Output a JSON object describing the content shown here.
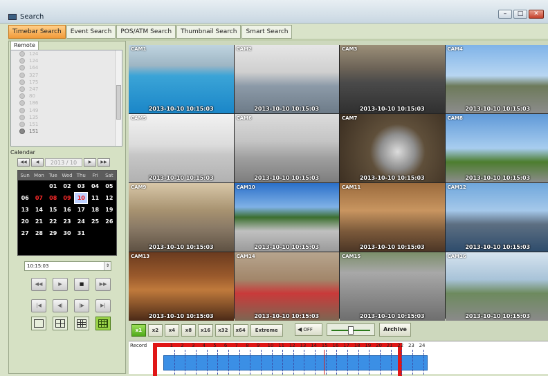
{
  "window": {
    "title": "Search"
  },
  "tabs": [
    {
      "label": "Timebar Search",
      "active": true
    },
    {
      "label": "Event Search"
    },
    {
      "label": "POS/ATM Search"
    },
    {
      "label": "Thumbnail Search"
    },
    {
      "label": "Smart Search"
    }
  ],
  "remote": {
    "tab_label": "Remote",
    "items": [
      "124",
      "124",
      "164",
      "327",
      "175",
      "247",
      "80",
      "186",
      "149",
      "135",
      "151"
    ]
  },
  "calendar": {
    "label": "Calendar",
    "month": "2013 / 10",
    "weekdays": [
      "Sun",
      "Mon",
      "Tue",
      "Wed",
      "Thu",
      "Fri",
      "Sat"
    ],
    "weeks": [
      [
        "",
        "",
        "01",
        "02",
        "03",
        "04",
        "05"
      ],
      [
        "06",
        "07",
        "08",
        "09",
        "10",
        "11",
        "12"
      ],
      [
        "13",
        "14",
        "15",
        "16",
        "17",
        "18",
        "19"
      ],
      [
        "20",
        "21",
        "22",
        "23",
        "24",
        "25",
        "26"
      ],
      [
        "27",
        "28",
        "29",
        "30",
        "31",
        "",
        ""
      ]
    ],
    "red_days": [
      "07",
      "08",
      "09"
    ],
    "selected_day": "10"
  },
  "time": "10:15:03",
  "cameras": [
    {
      "label": "CAM1",
      "timestamp": "2013-10-10 10:15:03"
    },
    {
      "label": "CAM2",
      "timestamp": "2013-10-10 10:15:03"
    },
    {
      "label": "CAM3",
      "timestamp": "2013-10-10 10:15:03"
    },
    {
      "label": "CAM4",
      "timestamp": "2013-10-10 10:15:03"
    },
    {
      "label": "CAM5",
      "timestamp": "2013-10-10 10:15:03"
    },
    {
      "label": "CAM6",
      "timestamp": "2013-10-10 10:15:03"
    },
    {
      "label": "CAM7",
      "timestamp": "2013-10-10 10:15:03"
    },
    {
      "label": "CAM8",
      "timestamp": "2013-10-10 10:15:03"
    },
    {
      "label": "CAM9",
      "timestamp": "2013-10-10 10:15:03"
    },
    {
      "label": "CAM10",
      "timestamp": "2013-10-10 10:15:03"
    },
    {
      "label": "CAM11",
      "timestamp": "2013-10-10 10:15:03"
    },
    {
      "label": "CAM12",
      "timestamp": "2013-10-10 10:15:03"
    },
    {
      "label": "CAM13",
      "timestamp": "2013-10-10 10:15:03"
    },
    {
      "label": "CAM14",
      "timestamp": "2013-10-10 10:15:03"
    },
    {
      "label": "CAM15",
      "timestamp": "2013-10-10 10:15:03"
    },
    {
      "label": "CAM16",
      "timestamp": "2013-10-10 10:15:03"
    }
  ],
  "speeds": [
    "x1",
    "x2",
    "x4",
    "x8",
    "x16",
    "x32",
    "x64",
    "Extreme"
  ],
  "audio_label": "OFF",
  "archive_label": "Archive",
  "timeline": {
    "label": "Record",
    "hours": [
      "1",
      "2",
      "3",
      "4",
      "5",
      "6",
      "7",
      "8",
      "9",
      "10",
      "11",
      "12",
      "13",
      "14",
      "15",
      "16",
      "17",
      "18",
      "19",
      "20",
      "21",
      "22",
      "23",
      "24"
    ]
  }
}
